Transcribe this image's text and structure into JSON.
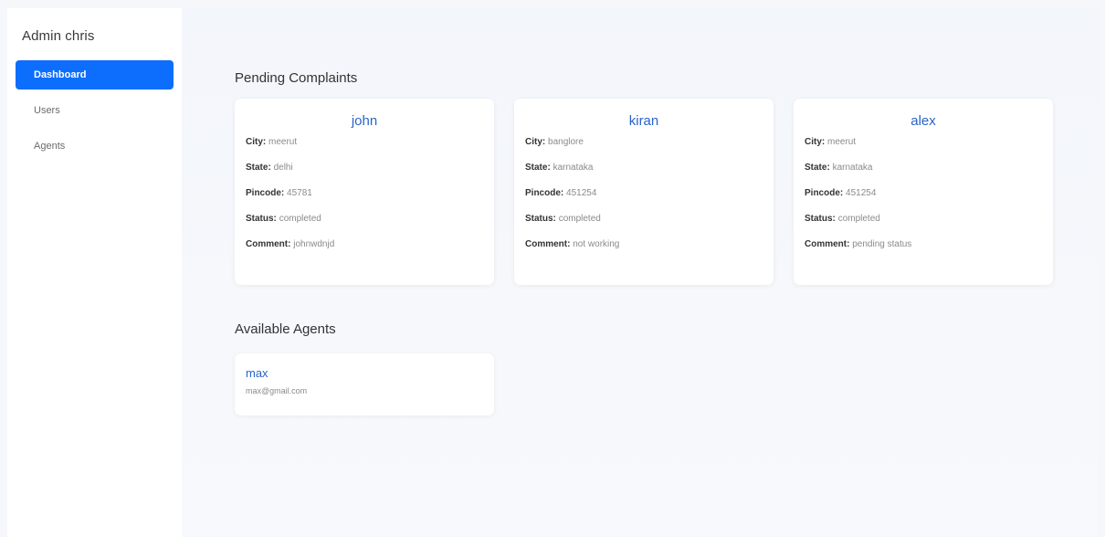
{
  "sidebar": {
    "brand": "Admin chris",
    "items": [
      {
        "label": "Dashboard",
        "active": true
      },
      {
        "label": "Users",
        "active": false
      },
      {
        "label": "Agents",
        "active": false
      }
    ]
  },
  "pending": {
    "title": "Pending Complaints",
    "field_labels": {
      "city": "City:",
      "state": "State:",
      "pincode": "Pincode:",
      "status": "Status:",
      "comment": "Comment:"
    },
    "complaints": [
      {
        "name": "john",
        "city": "meerut",
        "state": "delhi",
        "pincode": "45781",
        "status": "completed",
        "comment": "johnwdnjd"
      },
      {
        "name": "kiran",
        "city": "banglore",
        "state": "karnataka",
        "pincode": "451254",
        "status": "completed",
        "comment": "not working"
      },
      {
        "name": "alex",
        "city": "meerut",
        "state": "karnataka",
        "pincode": "451254",
        "status": "completed",
        "comment": "pending status"
      }
    ]
  },
  "agents": {
    "title": "Available Agents",
    "list": [
      {
        "name": "max",
        "email": "max@gmail.com"
      }
    ]
  },
  "colors": {
    "accent": "#0d6efd",
    "name_link": "#2a64c8"
  }
}
